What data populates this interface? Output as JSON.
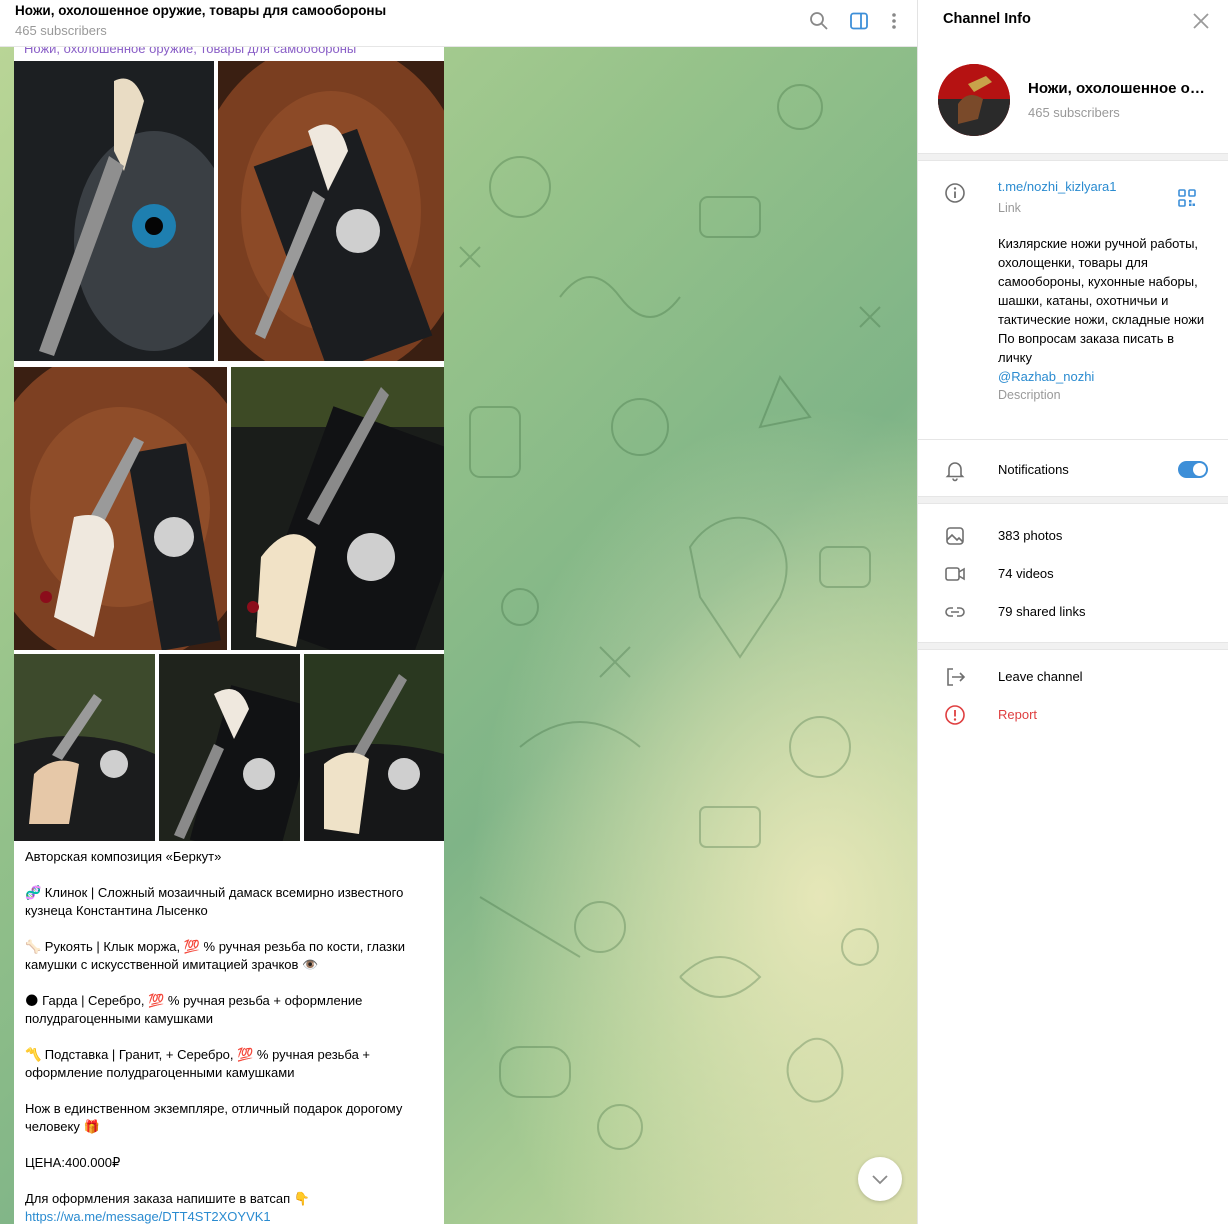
{
  "chat": {
    "title": "Ножи, охолошенное оружие, товары для самообороны",
    "subscribers": "465 subscribers",
    "header_icons": [
      "search-icon",
      "sidebar-toggle-icon",
      "more-vertical-icon"
    ]
  },
  "message": {
    "author": "Ножи, охолошенное оружие, товары для самообороны",
    "photo_count": 7,
    "lines": [
      "Авторская композиция «Беркут»",
      "",
      "🧬 Клинок | Сложный мозаичный дамаск всемирно известного кузнеца Константина Лысенко",
      "",
      "🦴 Рукоять | Клык моржа, 💯 % ручная резьба по кости, глазки камушки с искусственной имитацией зрачков 👁️",
      "",
      "🌑 Гарда | Серебро, 💯 % ручная резьба + оформление полудрагоценными камушками",
      "",
      "〽️ Подставка | Гранит, + Серебро, 💯 % ручная резьба + оформление полудрагоценными камушками",
      "",
      "Нож в единственном экземпляре, отличный подарок дорогому человеку 🎁",
      "",
      " ЦЕНА:400.000₽",
      "",
      "Для оформления заказа напишите в ватсап 👇"
    ],
    "link": "https://wa.me/message/DTT4ST2XOYVK1"
  },
  "info": {
    "title": "Channel Info",
    "channel_name": "Ножи, охолошенное оружие, товары для самообороны",
    "subscribers": "465 subscribers",
    "link": "t.me/nozhi_kizlyara1",
    "link_label": "Link",
    "description": "Кизлярские ножи ручной работы, охолощенки, товары для самообороны, кухонные наборы, шашки, катаны, охотничьи и тактические ножи, складные ножи\nПо вопросам заказа писать в личку",
    "description_mention": "@Razhab_nozhi",
    "description_label": "Description",
    "notifications_label": "Notifications",
    "notifications_on": true,
    "photos": "383 photos",
    "videos": "74 videos",
    "links": "79 shared links",
    "leave": "Leave channel",
    "report": "Report"
  },
  "colors": {
    "accent": "#3d8fd8",
    "link": "#2a8bd0",
    "author": "#8a5fc7",
    "danger": "#df3f40"
  }
}
